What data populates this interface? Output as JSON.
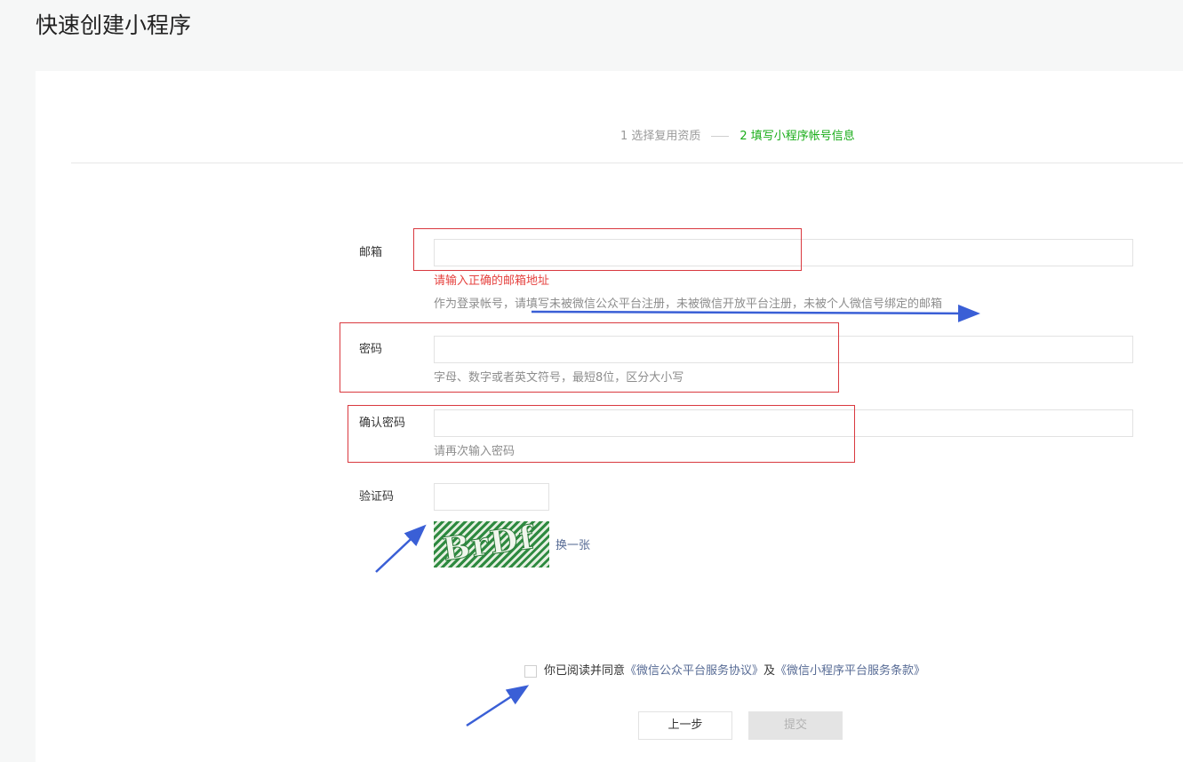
{
  "page": {
    "title": "快速创建小程序"
  },
  "steps": {
    "step1": "1 选择复用资质",
    "step2": "2 填写小程序帐号信息"
  },
  "form": {
    "email": {
      "label": "邮箱",
      "value": "",
      "error": "请输入正确的邮箱地址",
      "hint": "作为登录帐号，请填写未被微信公众平台注册，未被微信开放平台注册，未被个人微信号绑定的邮箱"
    },
    "password": {
      "label": "密码",
      "value": "",
      "hint": "字母、数字或者英文符号，最短8位，区分大小写"
    },
    "confirm": {
      "label": "确认密码",
      "value": "",
      "hint": "请再次输入密码"
    },
    "captcha": {
      "label": "验证码",
      "value": "",
      "image_text": "BrDf",
      "refresh": "换一张"
    }
  },
  "agreement": {
    "prefix": "你已阅读并同意",
    "link1": "《微信公众平台服务协议》",
    "middle": "及",
    "link2": "《微信小程序平台服务条款》",
    "checked": false
  },
  "buttons": {
    "prev": "上一步",
    "submit": "提交"
  },
  "colors": {
    "active_step": "#1aad19",
    "error": "#e64340",
    "link": "#576b95",
    "annotation_red": "#d9393f",
    "annotation_arrow": "#3a5fd6"
  }
}
